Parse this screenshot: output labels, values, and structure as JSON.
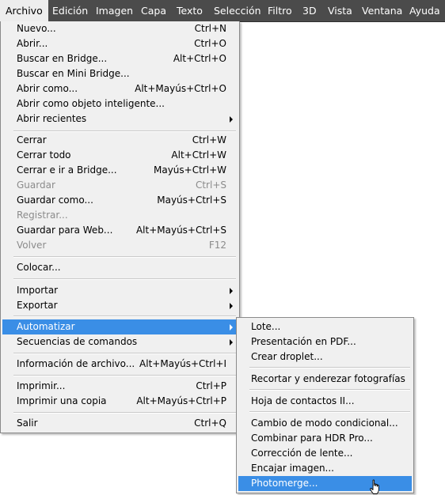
{
  "menubar": {
    "items": [
      "Archivo",
      "Edición",
      "Imagen",
      "Capa",
      "Texto",
      "Selección",
      "Filtro",
      "3D",
      "Vista",
      "Ventana",
      "Ayuda"
    ]
  },
  "archivo_menu": {
    "items": [
      {
        "label": "Nuevo...",
        "shortcut": "Ctrl+N"
      },
      {
        "label": "Abrir...",
        "shortcut": "Ctrl+O"
      },
      {
        "label": "Buscar en Bridge...",
        "shortcut": "Alt+Ctrl+O"
      },
      {
        "label": "Buscar en Mini Bridge...",
        "shortcut": ""
      },
      {
        "label": "Abrir como...",
        "shortcut": "Alt+Mayús+Ctrl+O"
      },
      {
        "label": "Abrir como objeto inteligente...",
        "shortcut": ""
      },
      {
        "label": "Abrir recientes",
        "shortcut": ""
      },
      {
        "label": "Cerrar",
        "shortcut": "Ctrl+W"
      },
      {
        "label": "Cerrar todo",
        "shortcut": "Alt+Ctrl+W"
      },
      {
        "label": "Cerrar e ir a Bridge...",
        "shortcut": "Mayús+Ctrl+W"
      },
      {
        "label": "Guardar",
        "shortcut": "Ctrl+S"
      },
      {
        "label": "Guardar como...",
        "shortcut": "Mayús+Ctrl+S"
      },
      {
        "label": "Registrar...",
        "shortcut": ""
      },
      {
        "label": "Guardar para Web...",
        "shortcut": "Alt+Mayús+Ctrl+S"
      },
      {
        "label": "Volver",
        "shortcut": "F12"
      },
      {
        "label": "Colocar...",
        "shortcut": ""
      },
      {
        "label": "Importar",
        "shortcut": ""
      },
      {
        "label": "Exportar",
        "shortcut": ""
      },
      {
        "label": "Automatizar",
        "shortcut": ""
      },
      {
        "label": "Secuencias de comandos",
        "shortcut": ""
      },
      {
        "label": "Información de archivo...",
        "shortcut": "Alt+Mayús+Ctrl+I"
      },
      {
        "label": "Imprimir...",
        "shortcut": "Ctrl+P"
      },
      {
        "label": "Imprimir una copia",
        "shortcut": "Alt+Mayús+Ctrl+P"
      },
      {
        "label": "Salir",
        "shortcut": "Ctrl+Q"
      }
    ]
  },
  "automatizar_submenu": {
    "items": [
      {
        "label": "Lote..."
      },
      {
        "label": "Presentación en PDF..."
      },
      {
        "label": "Crear droplet..."
      },
      {
        "label": "Recortar y enderezar fotografías"
      },
      {
        "label": "Hoja de contactos II..."
      },
      {
        "label": "Cambio de modo condicional..."
      },
      {
        "label": "Combinar para HDR Pro..."
      },
      {
        "label": "Corrección de lente..."
      },
      {
        "label": "Encajar imagen..."
      },
      {
        "label": "Photomerge..."
      }
    ]
  },
  "colors": {
    "menubar_bg": "#4b4b4b",
    "menu_bg": "#f0f0f0",
    "highlight": "#3a8ee6",
    "disabled_text": "#8b8b8b"
  }
}
